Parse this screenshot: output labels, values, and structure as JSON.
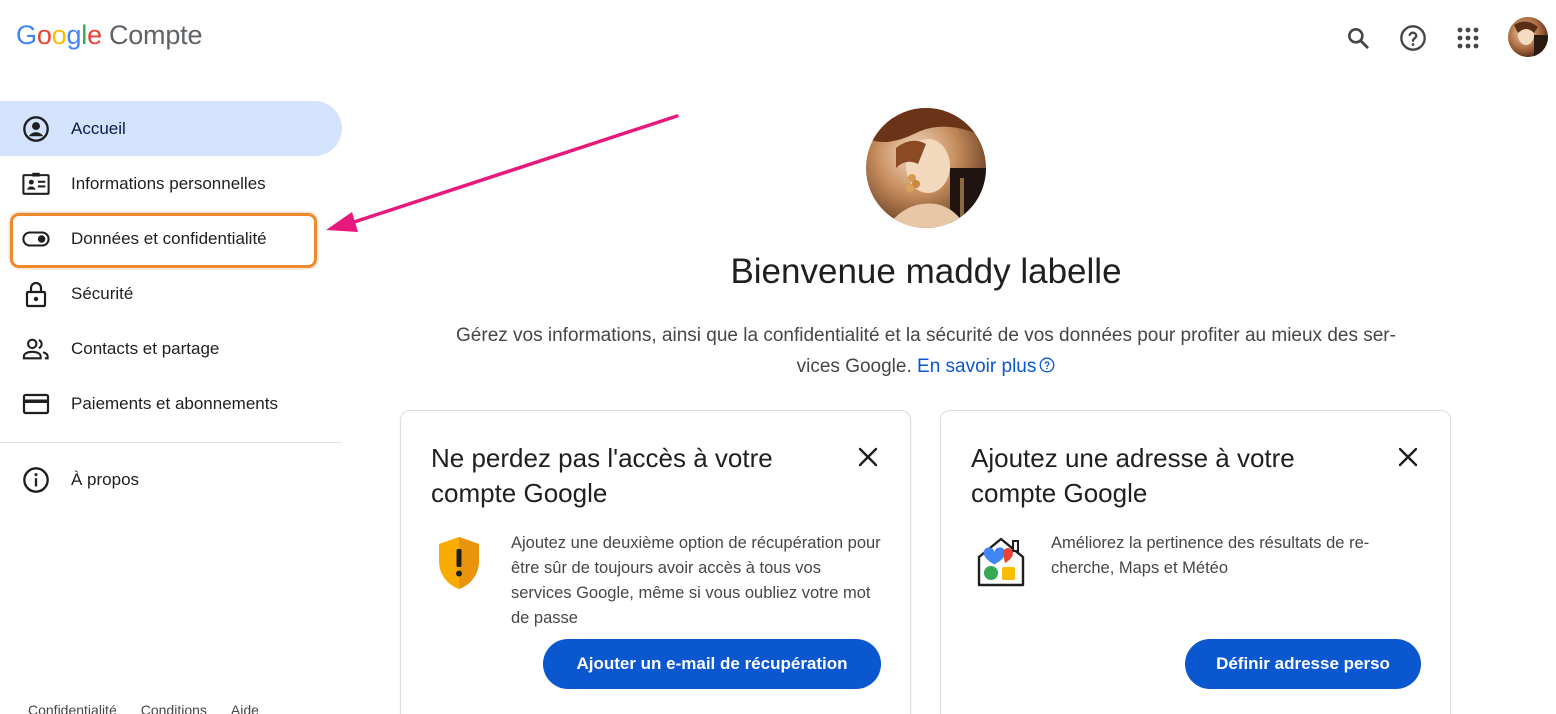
{
  "header": {
    "logo_letters": [
      "G",
      "o",
      "o",
      "g",
      "l",
      "e"
    ],
    "product": "Compte",
    "icons": [
      "search-icon",
      "help-icon",
      "apps-icon",
      "account-avatar"
    ]
  },
  "sidebar": {
    "items": [
      {
        "label": "Accueil",
        "icon": "account-circle-icon",
        "active": true
      },
      {
        "label": "Informations personnelles",
        "icon": "id-card-icon",
        "active": false
      },
      {
        "label": "Données et confidentialité",
        "icon": "toggle-icon",
        "active": false
      },
      {
        "label": "Sécurité",
        "icon": "lock-icon",
        "active": false
      },
      {
        "label": "Contacts et partage",
        "icon": "people-icon",
        "active": false
      },
      {
        "label": "Paiements et abonnements",
        "icon": "credit-card-icon",
        "active": false
      }
    ],
    "about": {
      "label": "À propos",
      "icon": "info-icon"
    }
  },
  "footer": {
    "links": [
      "Confidentialité",
      "Conditions",
      "Aide"
    ]
  },
  "main": {
    "welcome": "Bienvenue maddy labelle",
    "intro_line1": "Gérez vos informations, ainsi que la confidentialité et la sécurité de vos données pour profiter au mieux des ser-",
    "intro_line2": "vices Google.",
    "learn_more": "En savoir plus",
    "cards": [
      {
        "title": "Ne perdez pas l'accès à votre compte Google",
        "text": "Ajoutez une deuxième option de récupération pour être sûr de toujours avoir accès à tous vos services Google, même si vous oubliez votre mot de passe",
        "button": "Ajouter un e-mail de récupération",
        "icon": "shield-warning-icon"
      },
      {
        "title": "Ajoutez une adresse à votre compte Google",
        "text": "Améliorez la pertinence des résultats de re-cherche, Maps et Météo",
        "button": "Définir adresse perso",
        "icon": "home-address-icon"
      }
    ]
  },
  "colors": {
    "accent_blue": "#0b57d0",
    "nav_active_bg": "#d3e3fd",
    "highlight_box": "#ee8a2c",
    "annotation_arrow": "#e8197d",
    "shield_yellow": "#f9ab00"
  }
}
